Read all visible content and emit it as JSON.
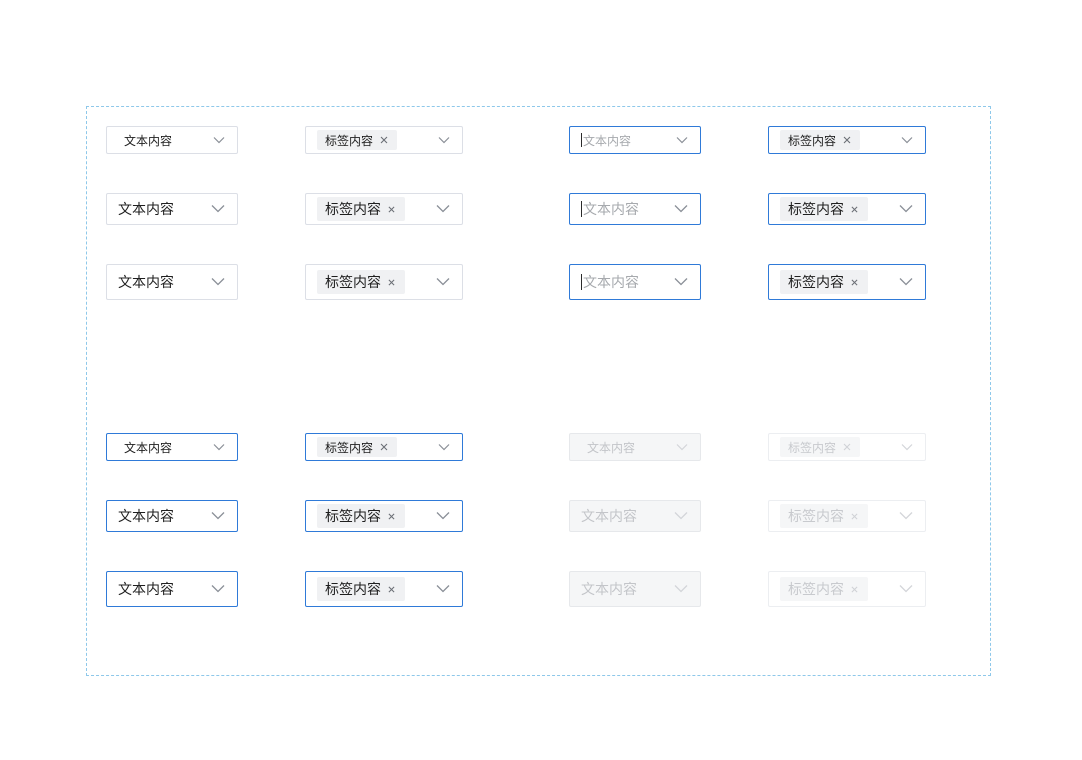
{
  "select": {
    "text_value": "文本内容",
    "text_placeholder": "文本内容",
    "tag_label": "标签内容"
  },
  "icons": {
    "dropdown": "chevron-down-icon",
    "tag_remove": "close-icon"
  },
  "colors": {
    "focus_border": "#2f7ad8",
    "default_border": "#dcdfe6",
    "disabled_bg": "#f5f6f7",
    "disabled_text": "#c3c5c9",
    "tag_bg": "#f0f1f3",
    "frame_border": "#8ec8ea"
  }
}
